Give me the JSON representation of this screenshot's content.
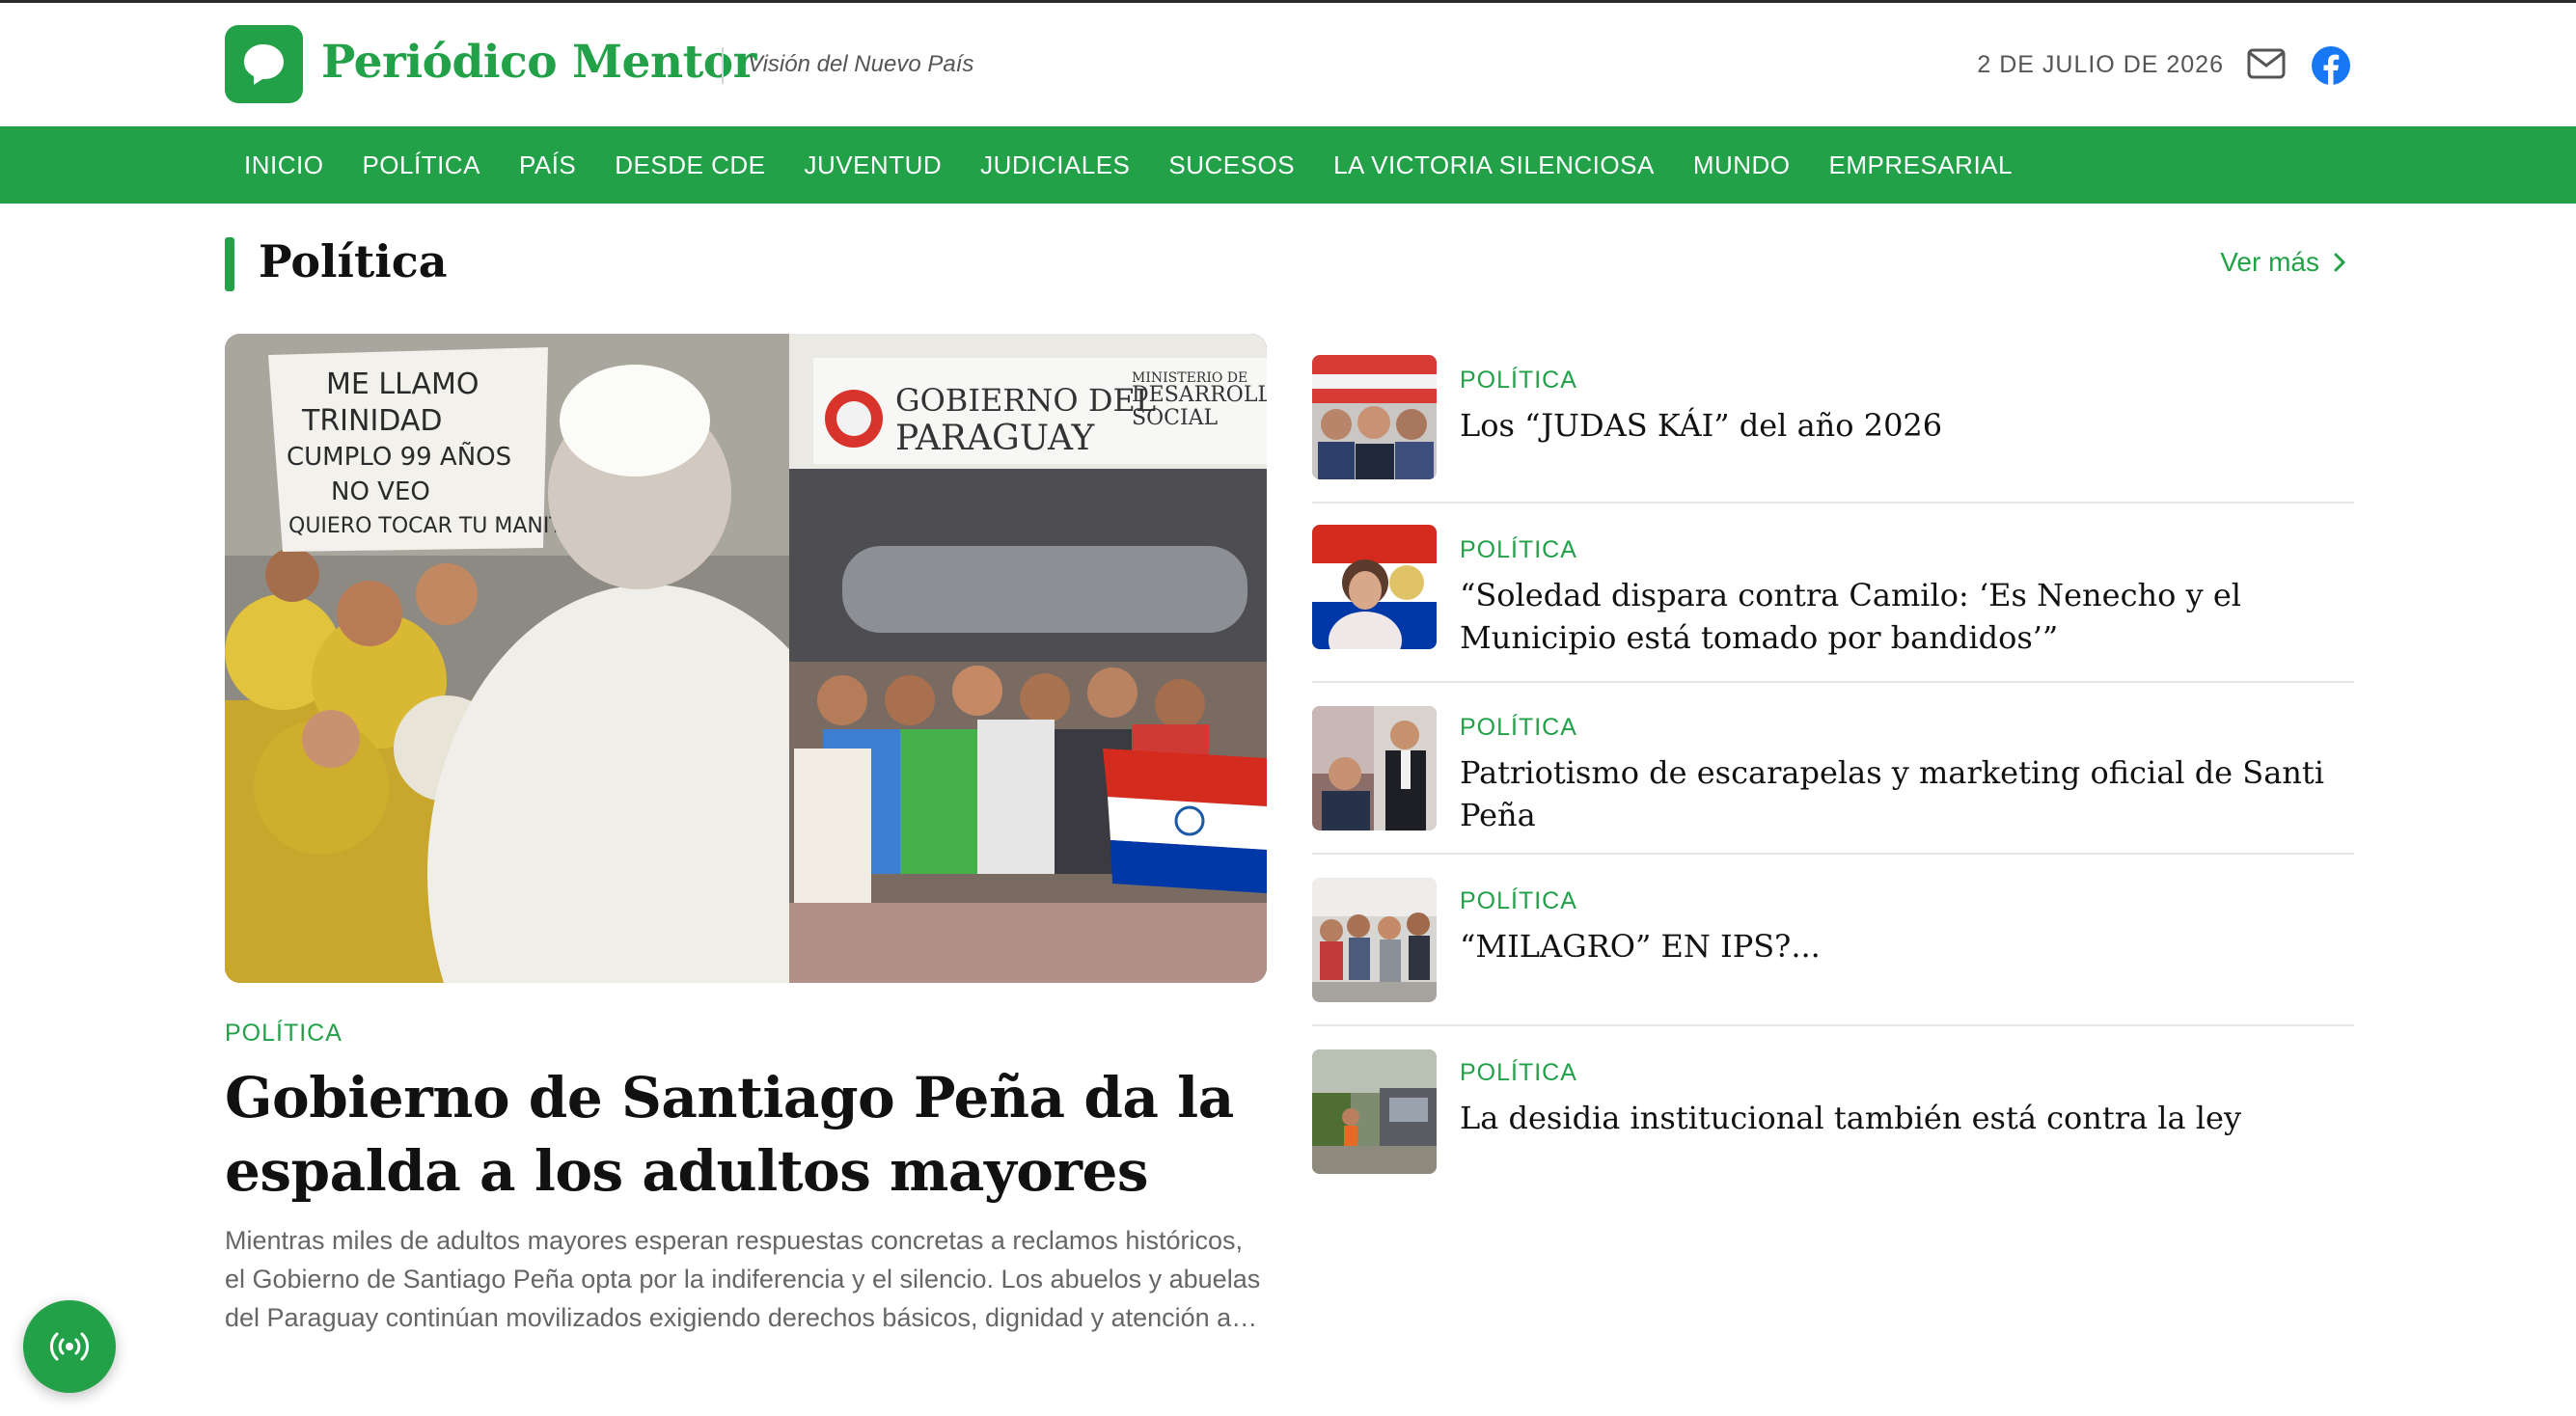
{
  "brand": {
    "name": "Periódico Mentor",
    "tagline": "Visión del Nuevo País",
    "accent": "#22a148"
  },
  "header": {
    "date": "2 DE JULIO DE 2026",
    "icons": [
      "mail-icon",
      "facebook-icon"
    ]
  },
  "nav": {
    "items": [
      {
        "label": "INICIO"
      },
      {
        "label": "POLÍTICA"
      },
      {
        "label": "PAÍS"
      },
      {
        "label": "DESDE CDE"
      },
      {
        "label": "JUVENTUD"
      },
      {
        "label": "JUDICIALES"
      },
      {
        "label": "SUCESOS"
      },
      {
        "label": "LA VICTORIA SILENCIOSA"
      },
      {
        "label": "MUNDO"
      },
      {
        "label": "EMPRESARIAL"
      }
    ]
  },
  "section": {
    "title": "Política",
    "more_label": "Ver más"
  },
  "featured": {
    "category": "POLÍTICA",
    "title": "Gobierno de Santiago Peña da la espalda a los adultos mayores",
    "excerpt": "Mientras miles de adultos mayores esperan respuestas concretas a reclamos históricos, el Gobierno de Santiago Peña opta por la indiferencia y el silencio. Los abuelos y abuelas del Paraguay continúan movilizados exigiendo derechos básicos, dignidad y atención a sus necesidades.",
    "image_texts": {
      "sign": [
        "ME LLAMO",
        "TRINIDAD",
        "CUMPLO 99 AÑOS",
        "NO VEO",
        "QUIERO TOCAR TU MANITO"
      ],
      "building": [
        "GOBIERNO DEL",
        "PARAGUAY",
        "MINISTERIO DE",
        "DESARROLLO",
        "SOCIAL"
      ]
    }
  },
  "articles": [
    {
      "category": "POLÍTICA",
      "title": "Los “JUDAS KÁI” del año 2026"
    },
    {
      "category": "POLÍTICA",
      "title": "“Soledad dispara contra Camilo: ‘Es Nenecho y el Municipio está tomado por bandidos’”"
    },
    {
      "category": "POLÍTICA",
      "title": "Patriotismo de escarapelas y marketing oficial de Santi Peña"
    },
    {
      "category": "POLÍTICA",
      "title": "“MILAGRO” EN IPS?..."
    },
    {
      "category": "POLÍTICA",
      "title": "La desidia institucional también está contra la ley"
    }
  ],
  "floating": {
    "icon": "radio-broadcast-icon"
  }
}
